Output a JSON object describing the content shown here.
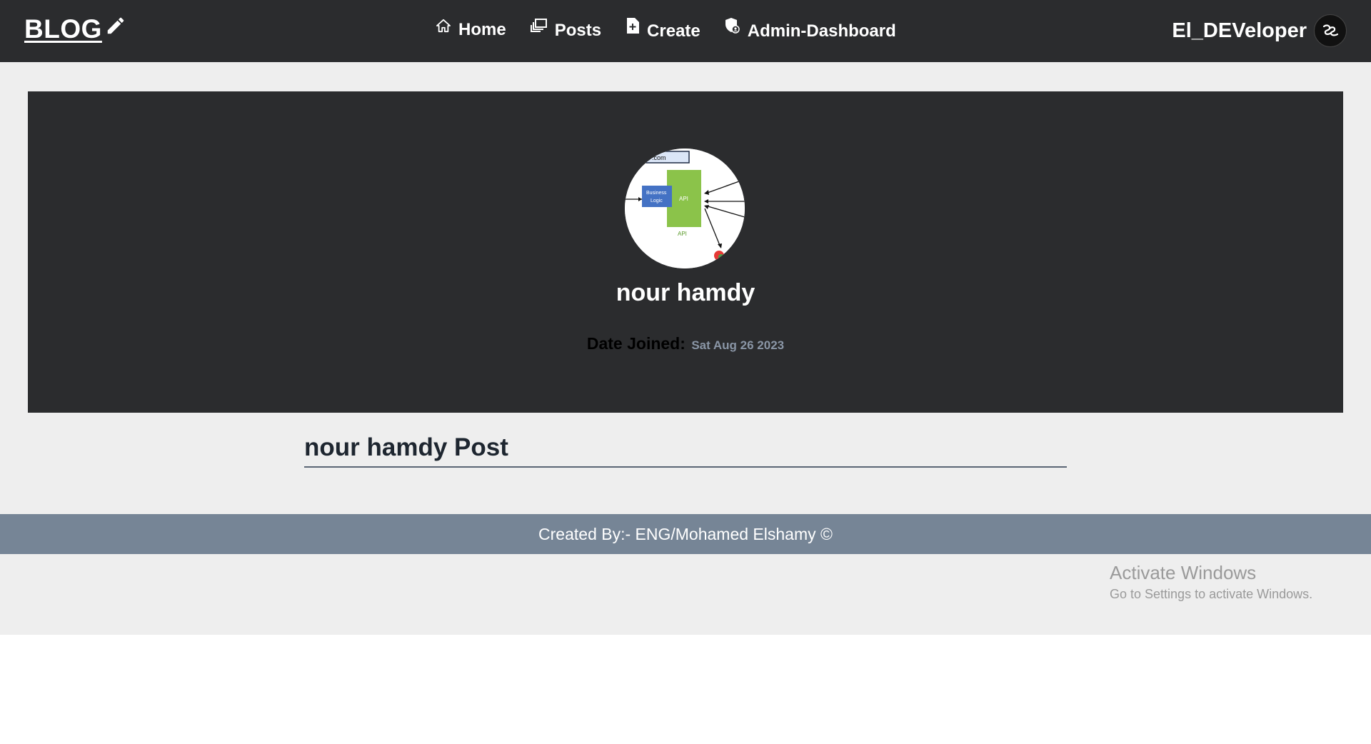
{
  "navbar": {
    "logo": "BLOG",
    "links": [
      {
        "label": "Home",
        "icon": "home-icon"
      },
      {
        "label": "Posts",
        "icon": "posts-icon"
      },
      {
        "label": "Create",
        "icon": "create-file-icon"
      },
      {
        "label": "Admin-Dashboard",
        "icon": "admin-shield-icon"
      }
    ],
    "user_name": "El_DEVeloper"
  },
  "profile": {
    "name": "nour hamdy",
    "date_joined_label": "Date Joined:",
    "date_joined_value": "Sat Aug 26 2023",
    "photo_labels": {
      "domain": ".com",
      "business_logic": "Business Logic",
      "api": "API",
      "api_caption": "API"
    }
  },
  "posts": {
    "title": "nour hamdy Post"
  },
  "footer": {
    "text": "Created By:- ENG/Mohamed Elshamy ©"
  },
  "watermark": {
    "title": "Activate Windows",
    "subtitle": "Go to Settings to activate Windows."
  },
  "colors": {
    "navbar_bg": "#2b2c2e",
    "page_bg": "#eeeeee",
    "footer_bg": "#768596",
    "api_green": "#8bc34a",
    "business_blue": "#4472c4"
  }
}
